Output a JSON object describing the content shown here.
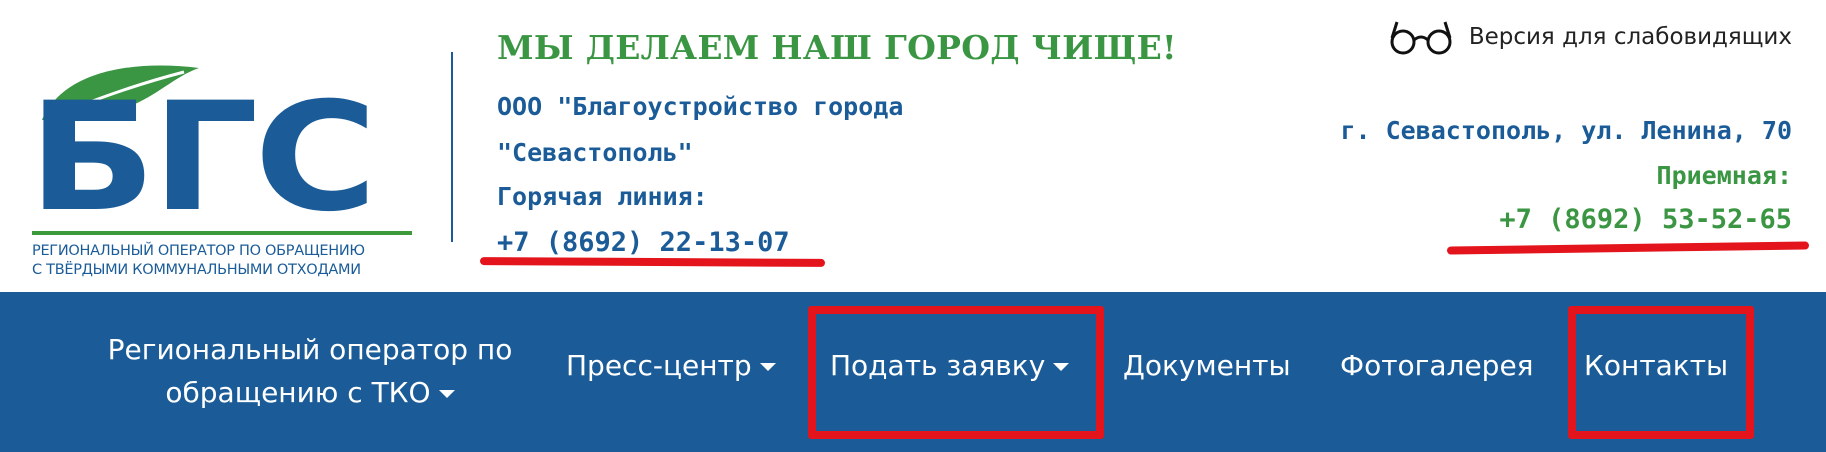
{
  "logo": {
    "letters": "БГС",
    "caption_line1": "Региональный оператор по обращению",
    "caption_line2": "с твёрдыми коммунальными отходами"
  },
  "header": {
    "slogan": "МЫ ДЕЛАЕМ НАШ ГОРОД ЧИЩЕ!",
    "company_line1": "ООО \"Благоустройство города",
    "company_line2": "\"Севастополь\"",
    "hotline_label": "Горячая линия:",
    "hotline_phone": "+7 (8692) 22-13-07",
    "accessibility_label": "Версия для слабовидящих",
    "address": "г. Севастополь, ул. Ленина, 70",
    "reception_label": "Приемная:",
    "reception_phone": "+7 (8692) 53-52-65"
  },
  "nav": {
    "regional_line1": "Региональный оператор по",
    "regional_line2": "обращению с ТКО",
    "press": "Пресс-центр",
    "request": "Подать заявку",
    "documents": "Документы",
    "gallery": "Фотогалерея",
    "contacts": "Контакты"
  },
  "colors": {
    "brand_blue": "#1b5c98",
    "brand_green": "#3a9642",
    "highlight_red": "#e3141b"
  },
  "icons": {
    "accessibility": "glasses-icon",
    "dropdown": "caret-down-icon",
    "logo_leaf": "leaf-icon"
  }
}
